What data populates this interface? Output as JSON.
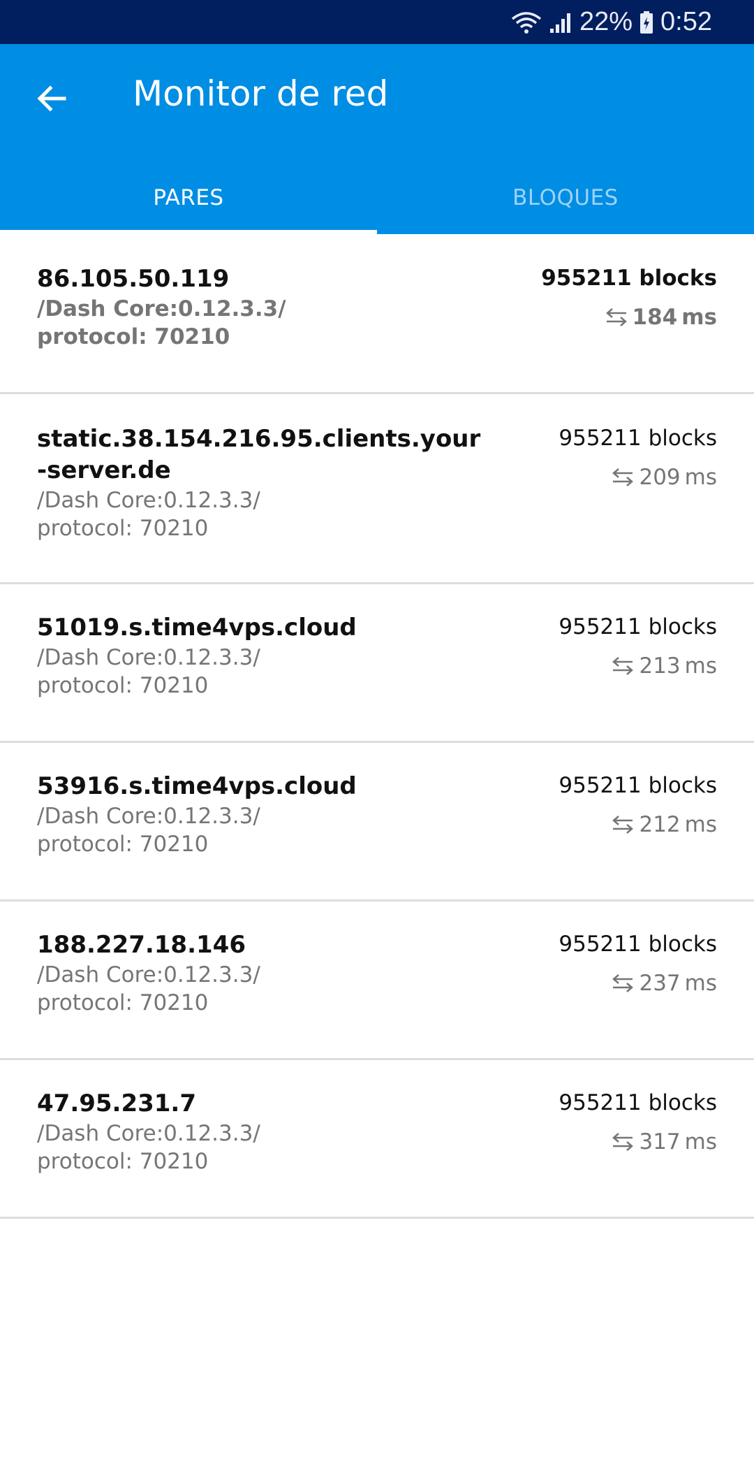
{
  "status_bar": {
    "battery": "22%",
    "time": "0:52",
    "color": "#011E5E"
  },
  "app_bar": {
    "title": "Monitor de red",
    "color": "#008DE4",
    "back_icon": "arrow-left-icon"
  },
  "tabs": [
    {
      "label": "PARES",
      "active": true
    },
    {
      "label": "BLOQUES",
      "active": false
    }
  ],
  "peers": [
    {
      "host": "86.105.50.119",
      "agent": "/Dash Core:0.12.3.3/",
      "protocol": "protocol: 70210",
      "blocks": "955211 blocks",
      "ping": "184",
      "ping_unit": "ms",
      "highlighted": true
    },
    {
      "host": "static.38.154.216.95.clients.your-server.de",
      "agent": "/Dash Core:0.12.3.3/",
      "protocol": "protocol: 70210",
      "blocks": "955211 blocks",
      "ping": "209",
      "ping_unit": "ms",
      "highlighted": false
    },
    {
      "host": "51019.s.time4vps.cloud",
      "agent": "/Dash Core:0.12.3.3/",
      "protocol": "protocol: 70210",
      "blocks": "955211 blocks",
      "ping": "213",
      "ping_unit": "ms",
      "highlighted": false
    },
    {
      "host": "53916.s.time4vps.cloud",
      "agent": "/Dash Core:0.12.3.3/",
      "protocol": "protocol: 70210",
      "blocks": "955211 blocks",
      "ping": "212",
      "ping_unit": "ms",
      "highlighted": false
    },
    {
      "host": "188.227.18.146",
      "agent": "/Dash Core:0.12.3.3/",
      "protocol": "protocol: 70210",
      "blocks": "955211 blocks",
      "ping": "237",
      "ping_unit": "ms",
      "highlighted": false
    },
    {
      "host": "47.95.231.7",
      "agent": "/Dash Core:0.12.3.3/",
      "protocol": "protocol: 70210",
      "blocks": "955211 blocks",
      "ping": "317",
      "ping_unit": "ms",
      "highlighted": false
    }
  ]
}
